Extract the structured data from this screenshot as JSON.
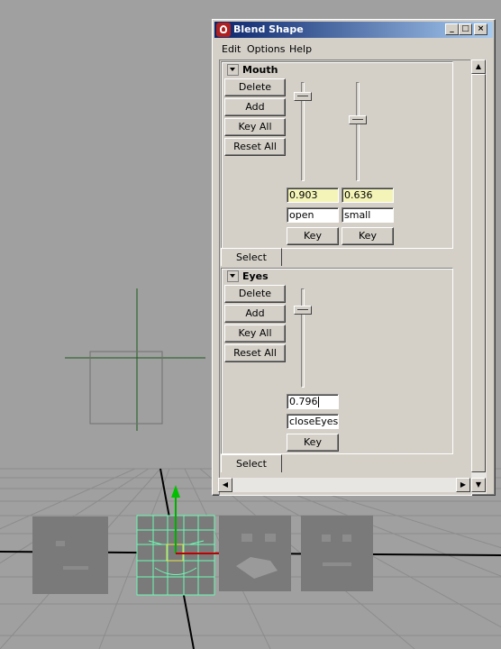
{
  "window": {
    "title": "Blend Shape",
    "controls": {
      "minimize": "_",
      "maximize": "□",
      "close": "×"
    }
  },
  "menu": [
    "Edit",
    "Options",
    "Help"
  ],
  "sections": [
    {
      "name": "Mouth",
      "buttons": [
        "Delete",
        "Add",
        "Key All",
        "Reset All"
      ],
      "targets": [
        {
          "value": "0.903",
          "name": "open",
          "key": "Key",
          "weight": 0.903
        },
        {
          "value": "0.636",
          "name": "small",
          "key": "Key",
          "weight": 0.636
        }
      ],
      "select": "Select"
    },
    {
      "name": "Eyes",
      "buttons": [
        "Delete",
        "Add",
        "Key All",
        "Reset All"
      ],
      "targets": [
        {
          "value": "0.796",
          "name": "closeEyes",
          "key": "Key",
          "weight": 0.796
        }
      ],
      "select": "Select"
    }
  ],
  "colors": {
    "title_start": "#0a246a",
    "title_end": "#a6caf0",
    "value_field": "#f4f4b8",
    "viewport_bg": "#a0a0a0",
    "grid": "#8c8c8c",
    "selected_wire": "#6dfab4"
  },
  "icons": {
    "title": "maya-icon",
    "scroll_up": "triangle-up",
    "scroll_down": "triangle-down",
    "scroll_left": "triangle-left",
    "scroll_right": "triangle-right",
    "collapse": "triangle-down"
  }
}
